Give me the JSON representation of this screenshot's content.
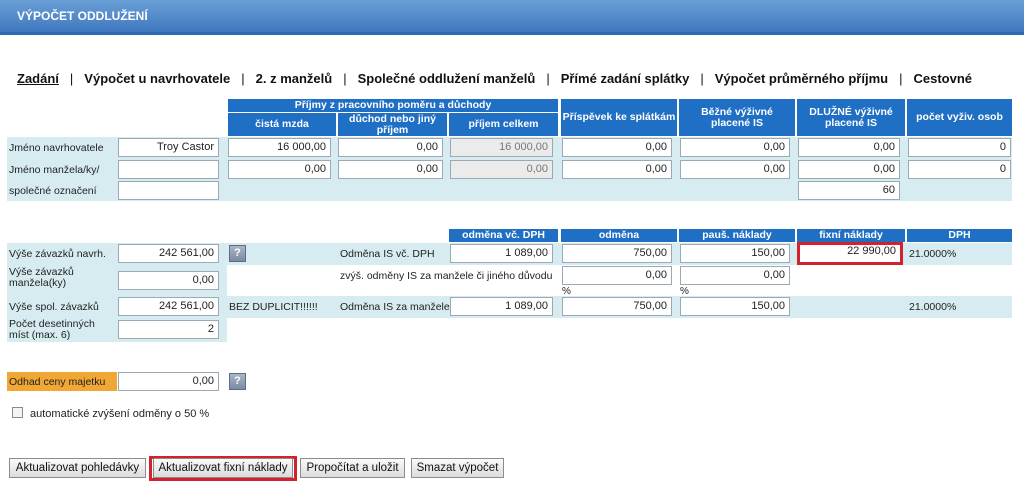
{
  "title": "VÝPOČET ODDLUŽENÍ",
  "tabs": [
    "Zadání",
    "Výpočet u navrhovatele",
    "2. z manželů",
    "Společné oddlužení manželů",
    "Přímé zadání splátky",
    "Výpočet průměrného příjmu",
    "Cestovné"
  ],
  "tab_separator": "|",
  "income_table": {
    "group_header": "Příjmy z pracovního poměru a důchody",
    "col_net": "čistá mzda",
    "col_pension": "důchod nebo jiný příjem",
    "col_total": "příjem celkem",
    "col_contribution": "Příspěvek ke splátkám",
    "col_alimony": "Běžné výživné placené IS",
    "col_debt_alimony": "DLUŽNÉ výživné placené IS",
    "col_count": "počet vyživ. osob",
    "row1_label": "Jméno navrhovatele",
    "row1_name": "Troy Castor",
    "row1_values": [
      "16 000,00",
      "0,00",
      "16 000,00",
      "0,00",
      "0,00",
      "0,00",
      "0"
    ],
    "row2_label": "Jméno manžela/ky/",
    "row2_name": "",
    "row2_values": [
      "0,00",
      "0,00",
      "0,00",
      "0,00",
      "0,00",
      "0,00",
      "0"
    ],
    "row3_label": "společné označení",
    "row3_name": "",
    "row3_value": "60"
  },
  "fees": {
    "hdr_fee_vat": "odměna vč. DPH",
    "hdr_fee": "odměna",
    "hdr_flat": "pauš. náklady",
    "hdr_fixed": "fixní náklady",
    "hdr_vat": "DPH",
    "debt1_label": "Výše závazků navrh.",
    "debt1_value": "242 561,00",
    "help_glyph": "?",
    "fee_is_label": "Odměna IS vč. DPH",
    "fee_is_vat": "1 089,00",
    "fee_is": "750,00",
    "flat_is": "150,00",
    "fixed_is": "22 990,00",
    "vat_rate": "21.0000%",
    "debt2_label": "Výše závazků manžela(ky)",
    "debt2_value": "0,00",
    "increase_label": "zvýš. odměny IS za manžele či jiného důvodu",
    "increase_fee": "0,00",
    "increase_flat": "0,00",
    "percent": "%",
    "joint_label": "Výše spol. závazků",
    "joint_value": "242 561,00",
    "no_dup": "BEZ DUPLICIT!!!!!!",
    "spouse_fee_label": "Odměna IS za manžele",
    "spouse_fee_vat": "1 089,00",
    "spouse_fee": "750,00",
    "spouse_flat": "150,00",
    "spouse_vat": "21.0000%",
    "decimals_label": "Počet desetinných míst (max. 6)",
    "decimals_value": "2"
  },
  "estimate_label": "Odhad ceny majetku",
  "estimate_value": "0,00",
  "auto_increase_label": "automatické zvýšení odměny o 50 %",
  "buttons": {
    "update_claims": "Aktualizovat pohledávky",
    "update_fixed": "Aktualizovat fixní náklady",
    "calc_save": "Propočítat a uložit",
    "delete": "Smazat výpočet"
  },
  "colors": {
    "header_blue": "#1f6fc4",
    "light_row": "#d7ecf1",
    "highlight_red": "#d1222d",
    "orange": "#f0a733"
  }
}
